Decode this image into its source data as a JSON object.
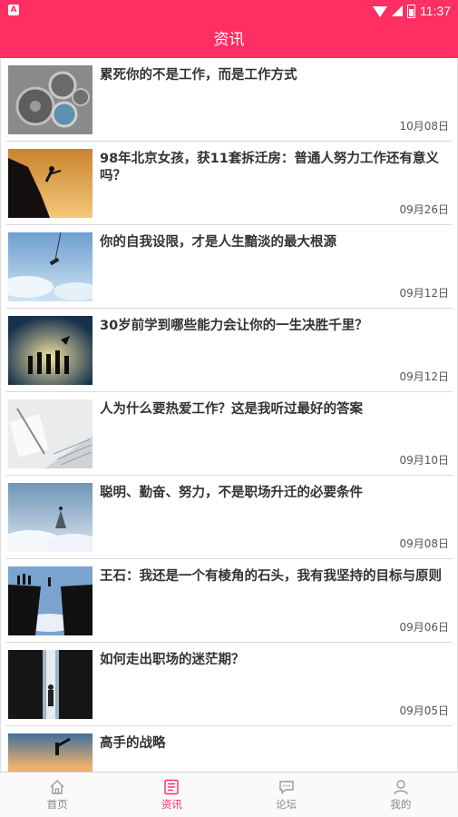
{
  "status_bar": {
    "time": "11:37",
    "app_badge": "A"
  },
  "header": {
    "title": "资讯"
  },
  "articles": [
    {
      "title": "累死你的不是工作，而是工作方式",
      "date": "10月08日",
      "image": "gears-image"
    },
    {
      "title": "98年北京女孩，获11套拆迁房：普通人努力工作还有意义吗？",
      "date": "09月26日",
      "image": "climber-silhouette-image"
    },
    {
      "title": "你的自我设限，才是人生黯淡的最大根源",
      "date": "09月12日",
      "image": "bungee-jump-image"
    },
    {
      "title": "30岁前学到哪些能力会让你的一生决胜千里？",
      "date": "09月12日",
      "image": "team-silhouette-image"
    },
    {
      "title": "人为什么要热爱工作？这是我听过最好的答案",
      "date": "09月10日",
      "image": "office-desk-image"
    },
    {
      "title": "聪明、勤奋、努力，不是职场升迁的必要条件",
      "date": "09月08日",
      "image": "man-above-clouds-image"
    },
    {
      "title": "王石：我还是一个有棱角的石头，我有我坚持的目标与原则",
      "date": "09月06日",
      "image": "cliff-jump-image"
    },
    {
      "title": "如何走出职场的迷茫期？",
      "date": "09月05日",
      "image": "dark-doorway-image"
    },
    {
      "title": "高手的战略",
      "date": "",
      "image": "sunset-kick-image"
    }
  ],
  "tabs": [
    {
      "label": "首页",
      "icon": "home-icon",
      "active": false
    },
    {
      "label": "资讯",
      "icon": "news-icon",
      "active": true
    },
    {
      "label": "论坛",
      "icon": "forum-icon",
      "active": false
    },
    {
      "label": "我的",
      "icon": "profile-icon",
      "active": false
    }
  ],
  "colors": {
    "accent": "#ff2e63",
    "tab_inactive": "#888888"
  }
}
